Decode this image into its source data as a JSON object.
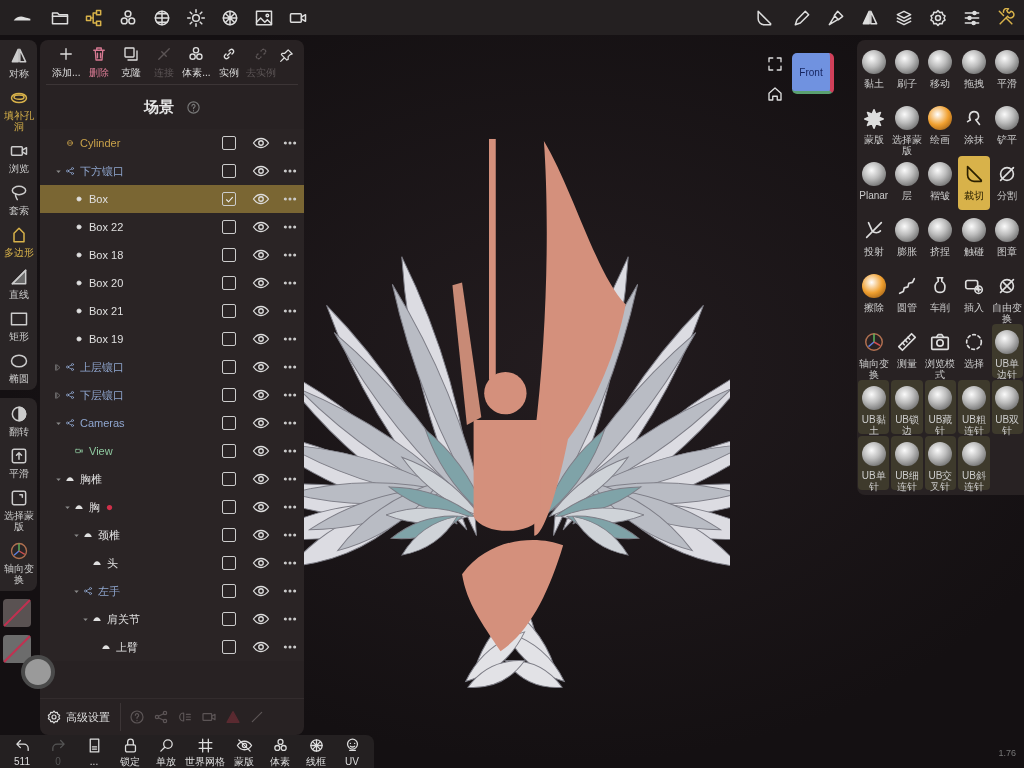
{
  "top_bar": {
    "left_icons": [
      {
        "selected": false
      },
      {
        "selected": false
      },
      {
        "selected": true
      },
      {
        "selected": false
      },
      {
        "selected": false
      },
      {
        "selected": false
      },
      {
        "selected": false
      },
      {
        "selected": false
      },
      {
        "selected": false
      }
    ],
    "right_icons": [
      {
        "selected": false
      },
      {
        "selected": false
      },
      {
        "selected": false
      },
      {
        "selected": false
      },
      {
        "selected": false
      },
      {
        "selected": false
      },
      {
        "selected": false
      },
      {
        "selected": true
      }
    ]
  },
  "left_toolbar": {
    "tools": [
      {
        "label": "对称",
        "selected": false
      },
      {
        "label": "填补孔洞",
        "selected": true
      },
      {
        "label": "浏览",
        "selected": false
      },
      {
        "label": "套索",
        "selected": false
      },
      {
        "label": "多边形",
        "selected": true
      },
      {
        "label": "直线",
        "selected": false
      },
      {
        "label": "矩形",
        "selected": false
      },
      {
        "label": "椭圆",
        "selected": false
      }
    ],
    "actions": [
      {
        "label": "翻转"
      },
      {
        "label": "平滑"
      },
      {
        "label": "选择蒙版"
      },
      {
        "label": "轴向变换"
      }
    ]
  },
  "scene": {
    "actions": [
      {
        "label": "添加...",
        "kind": "add",
        "disabled": false
      },
      {
        "label": "删除",
        "kind": "delete",
        "disabled": false
      },
      {
        "label": "克隆",
        "kind": "clone",
        "disabled": false
      },
      {
        "label": "连接",
        "kind": "connect",
        "disabled": true
      },
      {
        "label": "体素...",
        "kind": "voxel",
        "disabled": false
      },
      {
        "label": "实例",
        "kind": "instance",
        "disabled": false
      },
      {
        "label": "去实例",
        "kind": "uninstance",
        "disabled": true
      }
    ],
    "title": "场景",
    "tree": [
      {
        "name": "Cylinder",
        "kind": "primitive",
        "checked": false,
        "selected": false,
        "flagged": false
      },
      {
        "name": "下方镶口",
        "kind": "group",
        "checked": false,
        "selected": false,
        "flagged": false,
        "expanded": true,
        "children": [
          {
            "name": "Box",
            "kind": "mesh",
            "checked": true,
            "selected": true,
            "flagged": false
          },
          {
            "name": "Box 22",
            "kind": "mesh",
            "checked": false,
            "selected": false,
            "flagged": false
          },
          {
            "name": "Box 18",
            "kind": "mesh",
            "checked": false,
            "selected": false,
            "flagged": false
          },
          {
            "name": "Box 20",
            "kind": "mesh",
            "checked": false,
            "selected": false,
            "flagged": false
          },
          {
            "name": "Box 21",
            "kind": "mesh",
            "checked": false,
            "selected": false,
            "flagged": false
          },
          {
            "name": "Box 19",
            "kind": "mesh",
            "checked": false,
            "selected": false,
            "flagged": false
          }
        ]
      },
      {
        "name": "上层镶口",
        "kind": "group",
        "checked": false,
        "selected": false,
        "flagged": false,
        "expanded": false
      },
      {
        "name": "下层镶口",
        "kind": "group",
        "checked": false,
        "selected": false,
        "flagged": false,
        "expanded": false
      },
      {
        "name": "Cameras",
        "kind": "group",
        "checked": false,
        "selected": false,
        "flagged": false,
        "expanded": true,
        "children": [
          {
            "name": "View",
            "kind": "camera",
            "checked": false,
            "selected": false,
            "flagged": false
          }
        ]
      },
      {
        "name": "胸椎",
        "kind": "bone",
        "checked": false,
        "selected": false,
        "flagged": false,
        "expanded": true,
        "children": [
          {
            "name": "胸",
            "kind": "bone",
            "checked": false,
            "selected": false,
            "flagged": true,
            "expanded": true,
            "children": [
              {
                "name": "颈椎",
                "kind": "bone",
                "checked": false,
                "selected": false,
                "flagged": false,
                "expanded": true,
                "children": [
                  {
                    "name": "头",
                    "kind": "bone",
                    "checked": false,
                    "selected": false,
                    "flagged": false
                  }
                ]
              },
              {
                "name": "左手",
                "kind": "group",
                "checked": false,
                "selected": false,
                "flagged": false,
                "expanded": true,
                "children": [
                  {
                    "name": "肩关节",
                    "kind": "bone",
                    "checked": false,
                    "selected": false,
                    "flagged": false,
                    "expanded": true,
                    "children": [
                      {
                        "name": "上臂",
                        "kind": "bone",
                        "checked": false,
                        "selected": false,
                        "flagged": false
                      }
                    ]
                  }
                ]
              }
            ]
          }
        ]
      }
    ],
    "footer_label": "高级设置"
  },
  "viewport": {
    "view_cube": "Front"
  },
  "tools_panel": {
    "tools": [
      {
        "label": "黏土",
        "selected": false,
        "custom": false
      },
      {
        "label": "刷子",
        "selected": false,
        "custom": false
      },
      {
        "label": "移动",
        "selected": false,
        "custom": false
      },
      {
        "label": "拖拽",
        "selected": false,
        "custom": false
      },
      {
        "label": "平滑",
        "selected": false,
        "custom": false
      },
      {
        "label": "蒙版",
        "selected": false,
        "custom": false
      },
      {
        "label": "选择蒙版",
        "selected": false,
        "custom": false
      },
      {
        "label": "绘画",
        "selected": false,
        "custom": false
      },
      {
        "label": "涂抹",
        "selected": false,
        "custom": false
      },
      {
        "label": "铲平",
        "selected": false,
        "custom": false
      },
      {
        "label": "Planar",
        "selected": false,
        "custom": false
      },
      {
        "label": "层",
        "selected": false,
        "custom": false
      },
      {
        "label": "褶皱",
        "selected": false,
        "custom": false
      },
      {
        "label": "裁切",
        "selected": true,
        "custom": false
      },
      {
        "label": "分割",
        "selected": false,
        "custom": false
      },
      {
        "label": "投射",
        "selected": false,
        "custom": false
      },
      {
        "label": "膨胀",
        "selected": false,
        "custom": false
      },
      {
        "label": "挤捏",
        "selected": false,
        "custom": false
      },
      {
        "label": "触碰",
        "selected": false,
        "custom": false
      },
      {
        "label": "图章",
        "selected": false,
        "custom": false
      },
      {
        "label": "擦除",
        "selected": false,
        "custom": false
      },
      {
        "label": "圆管",
        "selected": false,
        "custom": false
      },
      {
        "label": "车削",
        "selected": false,
        "custom": false
      },
      {
        "label": "插入",
        "selected": false,
        "custom": false
      },
      {
        "label": "自由变换",
        "selected": false,
        "custom": false
      },
      {
        "label": "轴向变换",
        "selected": false,
        "custom": false
      },
      {
        "label": "测量",
        "selected": false,
        "custom": false
      },
      {
        "label": "浏览模式",
        "selected": false,
        "custom": false
      },
      {
        "label": "选择",
        "selected": false,
        "custom": false
      },
      {
        "label": "UB单边针",
        "selected": false,
        "custom": true
      },
      {
        "label": "UB黏土",
        "selected": false,
        "custom": true
      },
      {
        "label": "UB锁边",
        "selected": false,
        "custom": true
      },
      {
        "label": "UB藏针",
        "selected": false,
        "custom": true
      },
      {
        "label": "UB粗连针",
        "selected": false,
        "custom": true
      },
      {
        "label": "UB双针",
        "selected": false,
        "custom": true
      },
      {
        "label": "UB单针",
        "selected": false,
        "custom": true
      },
      {
        "label": "UB细连针",
        "selected": false,
        "custom": true
      },
      {
        "label": "UB交叉针",
        "selected": false,
        "custom": true
      },
      {
        "label": "UB斜连针",
        "selected": false,
        "custom": true
      }
    ]
  },
  "bottom_bar": {
    "items": [
      {
        "label": "511",
        "kind": "undo",
        "disabled": false
      },
      {
        "label": "0",
        "kind": "redo",
        "disabled": true
      },
      {
        "label": "...",
        "kind": "layers",
        "disabled": false
      },
      {
        "label": "锁定",
        "kind": "lock",
        "disabled": false
      },
      {
        "label": "单放",
        "kind": "zoom",
        "disabled": false
      },
      {
        "label": "世界网格",
        "kind": "grid",
        "disabled": false
      },
      {
        "label": "蒙版",
        "kind": "mask",
        "disabled": false
      },
      {
        "label": "体素",
        "kind": "voxel",
        "disabled": false
      },
      {
        "label": "线框",
        "kind": "wire",
        "disabled": false
      },
      {
        "label": "UV",
        "kind": "uv",
        "disabled": false
      }
    ]
  },
  "version": "1.76"
}
